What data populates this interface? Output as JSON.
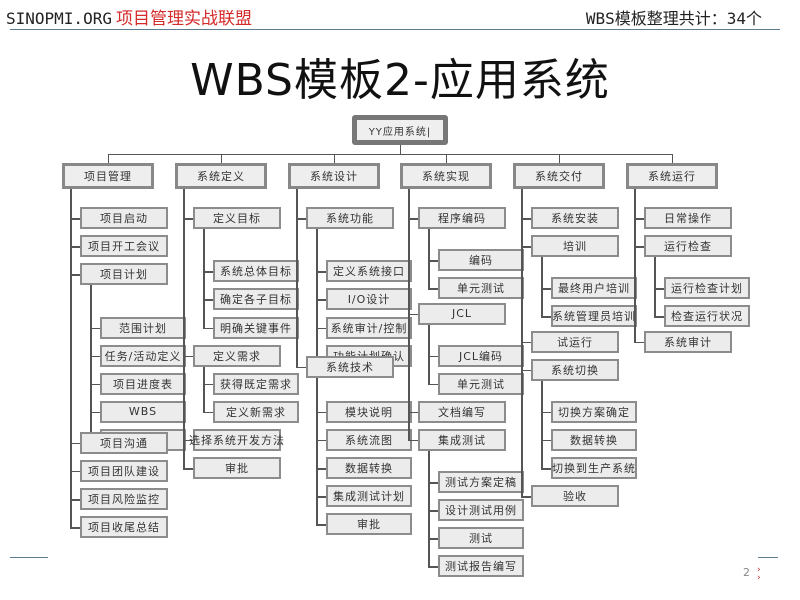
{
  "header": {
    "site": "SINOPMI.ORG",
    "org": "项目管理实战联盟",
    "count_label": "WBS模板整理共计：34个"
  },
  "title": "WBS模板2-应用系统",
  "tree": {
    "root": "YY应用系统|",
    "branches": [
      {
        "label": "项目管理",
        "children": [
          {
            "label": "项目启动"
          },
          {
            "label": "项目开工会议"
          },
          {
            "label": "项目计划",
            "children": [
              "范围计划",
              "任务/活动定义",
              "项目进度表",
              "WBS",
              "质量计划"
            ]
          },
          {
            "label": "项目沟通"
          },
          {
            "label": "项目团队建设"
          },
          {
            "label": "项目风险监控"
          },
          {
            "label": "项目收尾总结"
          }
        ]
      },
      {
        "label": "系统定义",
        "children": [
          {
            "label": "定义目标",
            "children": [
              "系统总体目标",
              "确定各子目标",
              "明确关键事件"
            ]
          },
          {
            "label": "定义需求",
            "children": [
              "获得既定需求",
              "定义新需求"
            ]
          },
          {
            "label": "选择系统开发方法"
          },
          {
            "label": "审批"
          }
        ]
      },
      {
        "label": "系统设计",
        "children": [
          {
            "label": "系统功能",
            "children": [
              "定义系统接口",
              "I/O设计",
              "系统审计/控制",
              "功能计划确认"
            ]
          },
          {
            "label": "系统技术",
            "children": [
              "模块说明",
              "系统流图",
              "数据转换",
              "集成测试计划",
              "审批"
            ]
          }
        ]
      },
      {
        "label": "系统实现",
        "children": [
          {
            "label": "程序编码",
            "children": [
              "编码",
              "单元测试"
            ]
          },
          {
            "label": "JCL",
            "children": [
              "JCL编码",
              "单元测试"
            ]
          },
          {
            "label": "文档编写"
          },
          {
            "label": "集成测试",
            "children": [
              "测试方案定稿",
              "设计测试用例",
              "测试",
              "测试报告编写"
            ]
          }
        ]
      },
      {
        "label": "系统交付",
        "children": [
          {
            "label": "系统安装"
          },
          {
            "label": "培训",
            "children": [
              "最终用户培训",
              "系统管理员培训"
            ]
          },
          {
            "label": "试运行"
          },
          {
            "label": "系统切换",
            "children": [
              "切换方案确定",
              "数据转换",
              "切换到生产系统"
            ]
          },
          {
            "label": "验收"
          }
        ]
      },
      {
        "label": "系统运行",
        "children": [
          {
            "label": "日常操作"
          },
          {
            "label": "运行检查",
            "children": [
              "运行检查计划",
              "检查运行状况"
            ]
          },
          {
            "label": "系统审计"
          }
        ]
      }
    ]
  },
  "footer": {
    "page_number": "2"
  }
}
